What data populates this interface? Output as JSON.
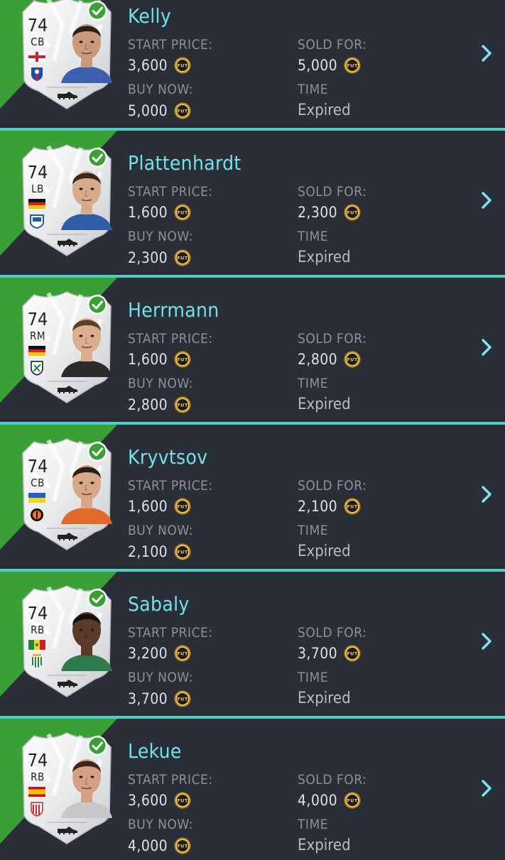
{
  "labels": {
    "start_price": "START PRICE:",
    "buy_now": "BUY NOW:",
    "sold_for": "SOLD FOR:",
    "time": "TIME"
  },
  "colors": {
    "background": "#262a33",
    "accent_line": "#4fcfc4",
    "sold_green": "#3aa035",
    "name": "#72e0ea",
    "coin_gold": "#e8b33b"
  },
  "icons": [
    "fut-coin-icon",
    "chevron-right-icon",
    "checkmark-icon",
    "boot-icon",
    "flag-icon",
    "club-badge-icon"
  ],
  "items": [
    {
      "name": "Kelly",
      "rating": "74",
      "position": "CB",
      "nation": "england",
      "club": "crystal-palace",
      "start_price": "3,600",
      "buy_now": "5,000",
      "sold_for": "5,000",
      "time": "Expired",
      "coin": "FUT"
    },
    {
      "name": "Plattenhardt",
      "rating": "74",
      "position": "LB",
      "nation": "germany",
      "club": "hertha-berlin",
      "start_price": "1,600",
      "buy_now": "2,300",
      "sold_for": "2,300",
      "time": "Expired",
      "coin": "FUT"
    },
    {
      "name": "Herrmann",
      "rating": "74",
      "position": "RM",
      "nation": "germany",
      "club": "borussia-monchengladbach",
      "start_price": "1,600",
      "buy_now": "2,800",
      "sold_for": "2,800",
      "time": "Expired",
      "coin": "FUT"
    },
    {
      "name": "Kryvtsov",
      "rating": "74",
      "position": "CB",
      "nation": "ukraine",
      "club": "shakhtar-donetsk",
      "start_price": "1,600",
      "buy_now": "2,100",
      "sold_for": "2,100",
      "time": "Expired",
      "coin": "FUT"
    },
    {
      "name": "Sabaly",
      "rating": "74",
      "position": "RB",
      "nation": "senegal",
      "club": "real-betis",
      "start_price": "3,200",
      "buy_now": "3,700",
      "sold_for": "3,700",
      "time": "Expired",
      "coin": "FUT"
    },
    {
      "name": "Lekue",
      "rating": "74",
      "position": "RB",
      "nation": "spain",
      "club": "athletic-bilbao",
      "start_price": "3,600",
      "buy_now": "4,000",
      "sold_for": "4,000",
      "time": "Expired",
      "coin": "FUT"
    }
  ]
}
